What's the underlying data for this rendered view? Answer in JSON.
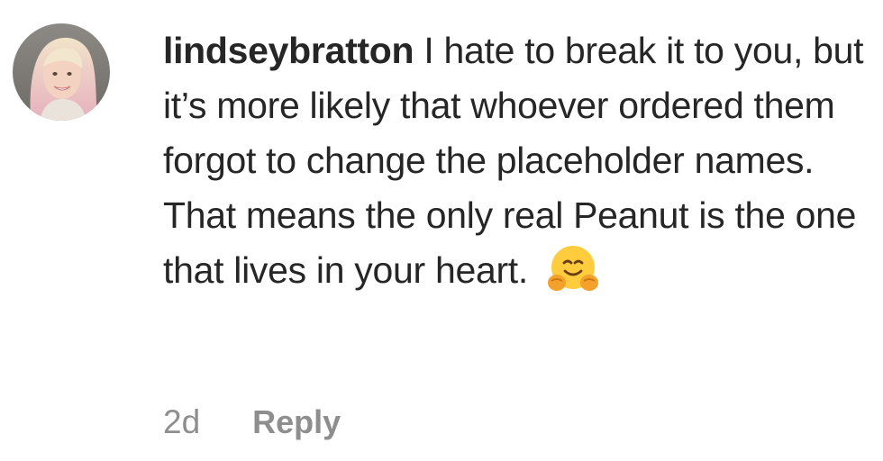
{
  "comment": {
    "username": "lindseybratton",
    "text": "I hate to break it to you, but it’s more likely that whoever ordered them forgot to change the placeholder names. That means the only real Peanut is the one that lives in your heart.",
    "emoji": "hugging-face",
    "time_ago": "2d",
    "reply_label": "Reply"
  },
  "colors": {
    "text": "#262626",
    "secondary": "#8e8e8e"
  }
}
